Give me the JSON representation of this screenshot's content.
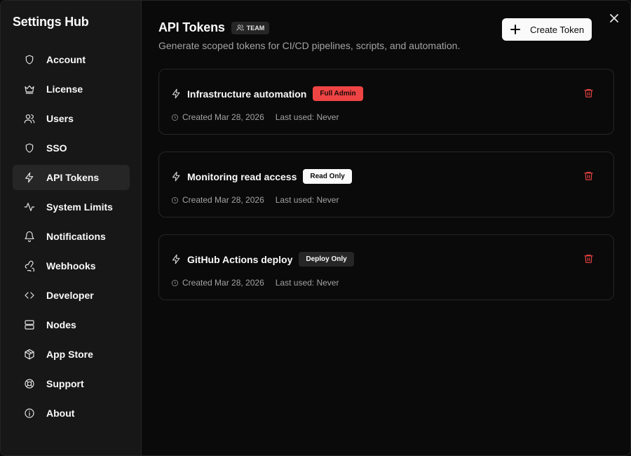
{
  "app": {
    "title": "Settings Hub"
  },
  "sidebar": {
    "items": [
      {
        "label": "Account",
        "icon": "shield-icon",
        "active": false
      },
      {
        "label": "License",
        "icon": "crown-icon",
        "active": false
      },
      {
        "label": "Users",
        "icon": "users-icon",
        "active": false
      },
      {
        "label": "SSO",
        "icon": "shield-icon",
        "active": false
      },
      {
        "label": "API Tokens",
        "icon": "bolt-icon",
        "active": true
      },
      {
        "label": "System Limits",
        "icon": "activity-icon",
        "active": false
      },
      {
        "label": "Notifications",
        "icon": "bell-icon",
        "active": false
      },
      {
        "label": "Webhooks",
        "icon": "webhook-icon",
        "active": false
      },
      {
        "label": "Developer",
        "icon": "code-icon",
        "active": false
      },
      {
        "label": "Nodes",
        "icon": "server-icon",
        "active": false
      },
      {
        "label": "App Store",
        "icon": "package-icon",
        "active": false
      },
      {
        "label": "Support",
        "icon": "lifebuoy-icon",
        "active": false
      },
      {
        "label": "About",
        "icon": "info-icon",
        "active": false
      }
    ]
  },
  "header": {
    "title": "API Tokens",
    "badge": "TEAM",
    "subtitle": "Generate scoped tokens for CI/CD pipelines, scripts, and automation.",
    "create_label": "Create Token"
  },
  "tokens": [
    {
      "name": "Infrastructure automation",
      "scope": "Full Admin",
      "scope_style": "admin",
      "created": "Created Mar 28, 2026",
      "last_used": "Last used: Never"
    },
    {
      "name": "Monitoring read access",
      "scope": "Read Only",
      "scope_style": "read",
      "created": "Created Mar 28, 2026",
      "last_used": "Last used: Never"
    },
    {
      "name": "GitHub Actions deploy",
      "scope": "Deploy Only",
      "scope_style": "deploy",
      "created": "Created Mar 28, 2026",
      "last_used": "Last used: Never"
    }
  ],
  "colors": {
    "danger": "#ef4444",
    "background": "#0a0a0a",
    "sidebar": "#171717",
    "border": "#262626"
  }
}
